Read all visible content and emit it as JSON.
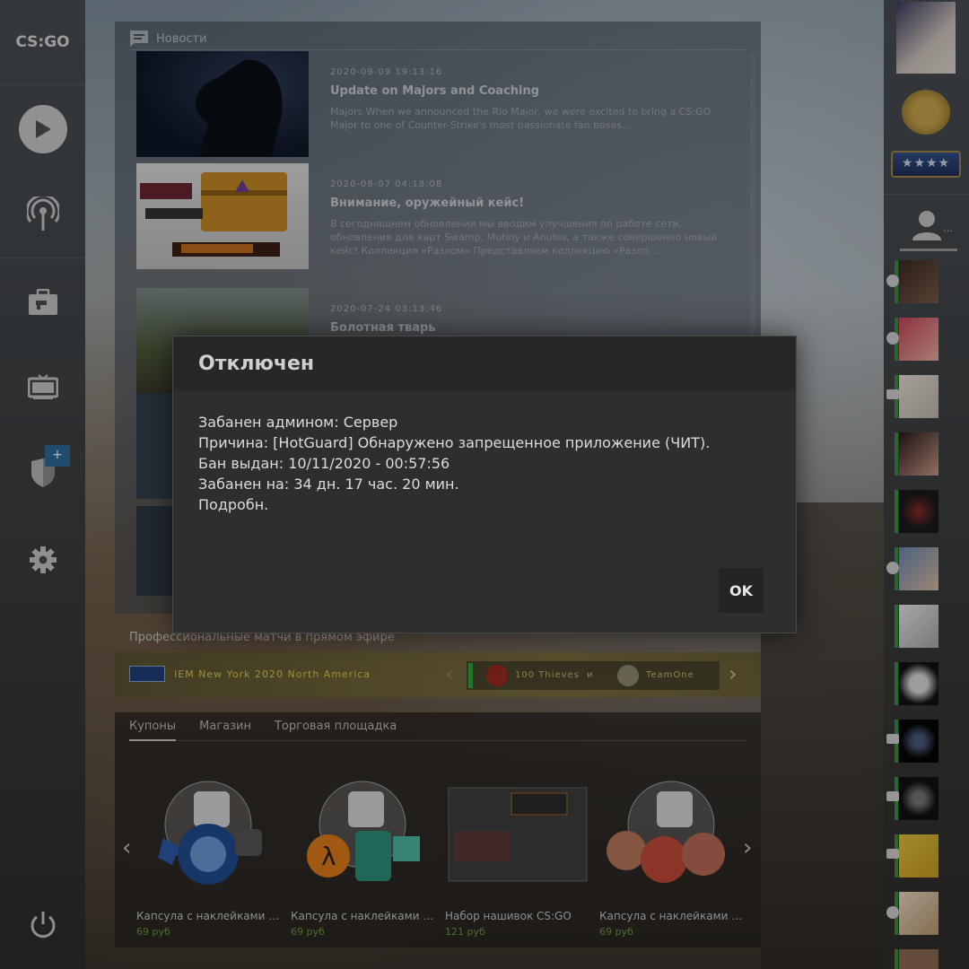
{
  "logo": {
    "text": "CS:GO"
  },
  "nav": {
    "icons": [
      "play-icon",
      "broadcast-icon",
      "briefcase-icon",
      "tv-icon",
      "shield-icon",
      "gear-icon",
      "power-icon"
    ],
    "shield_badge": "+"
  },
  "news": {
    "header": "Новости",
    "items": [
      {
        "date": "2020-09-09 19:13:16",
        "title": "Update on Majors and Coaching",
        "body": "Majors When we announced the Rio Major, we were excited to bring a CS:GO Major to one of Counter-Strike's most passionate fan bases…"
      },
      {
        "date": "2020-08-07 04:18:08",
        "title": "Внимание, оружейный кейс!",
        "body": "В сегодняшнем обновлении мы вводим улучшения по работе сети, обновления для карт Swamp, Mutiny и Anubis, а также совершенно новый кейс! Коллекция «Разлом» Представляем коллекцию «Разло…"
      },
      {
        "date": "2020-07-24 03:13:46",
        "title": "Болотная тварь",
        "body": ""
      }
    ]
  },
  "pro_matches": {
    "label": "Профессиональные матчи в прямом эфире",
    "event": "IEM New York 2020 North America",
    "team1": "100 Thieves",
    "vs": "и",
    "team2": "TeamOne"
  },
  "store": {
    "tabs": [
      "Купоны",
      "Магазин",
      "Торговая площадка"
    ],
    "items": [
      {
        "name": "Капсула с наклейками …",
        "price": "69 руб"
      },
      {
        "name": "Капсула с наклейками …",
        "price": "69 руб"
      },
      {
        "name": "Набор нашивок CS:GO",
        "price": "121 руб"
      },
      {
        "name": "Капсула с наклейками …",
        "price": "69 руб"
      }
    ]
  },
  "rank": {
    "stars": "★★★★"
  },
  "friends": {
    "add_label": "…",
    "list": [
      {
        "status": "playing"
      },
      {
        "status": "playing"
      },
      {
        "status": "tv"
      },
      {
        "status": "online"
      },
      {
        "status": "online"
      },
      {
        "status": "playing"
      },
      {
        "status": "online"
      },
      {
        "status": "online"
      },
      {
        "status": "tv"
      },
      {
        "status": "tv"
      },
      {
        "status": "tv"
      },
      {
        "status": "playing"
      }
    ]
  },
  "dialog": {
    "title": "Отключен",
    "lines": [
      "Забанен админом: Сервер",
      "Причина: [HotGuard]  Обнаружено запрещенное приложение (ЧИТ).",
      "Бан выдан: 10/11/2020 - 00:57:56",
      "Забанен на: 34 дн. 17 час. 20 мин.",
      "Подробн."
    ],
    "ok_label": "OK"
  },
  "colors": {
    "accent_green": "#37a33c",
    "price_green": "#6a9a3e",
    "event_gold": "#e0c64a",
    "badge_blue": "#2b6a9a"
  }
}
